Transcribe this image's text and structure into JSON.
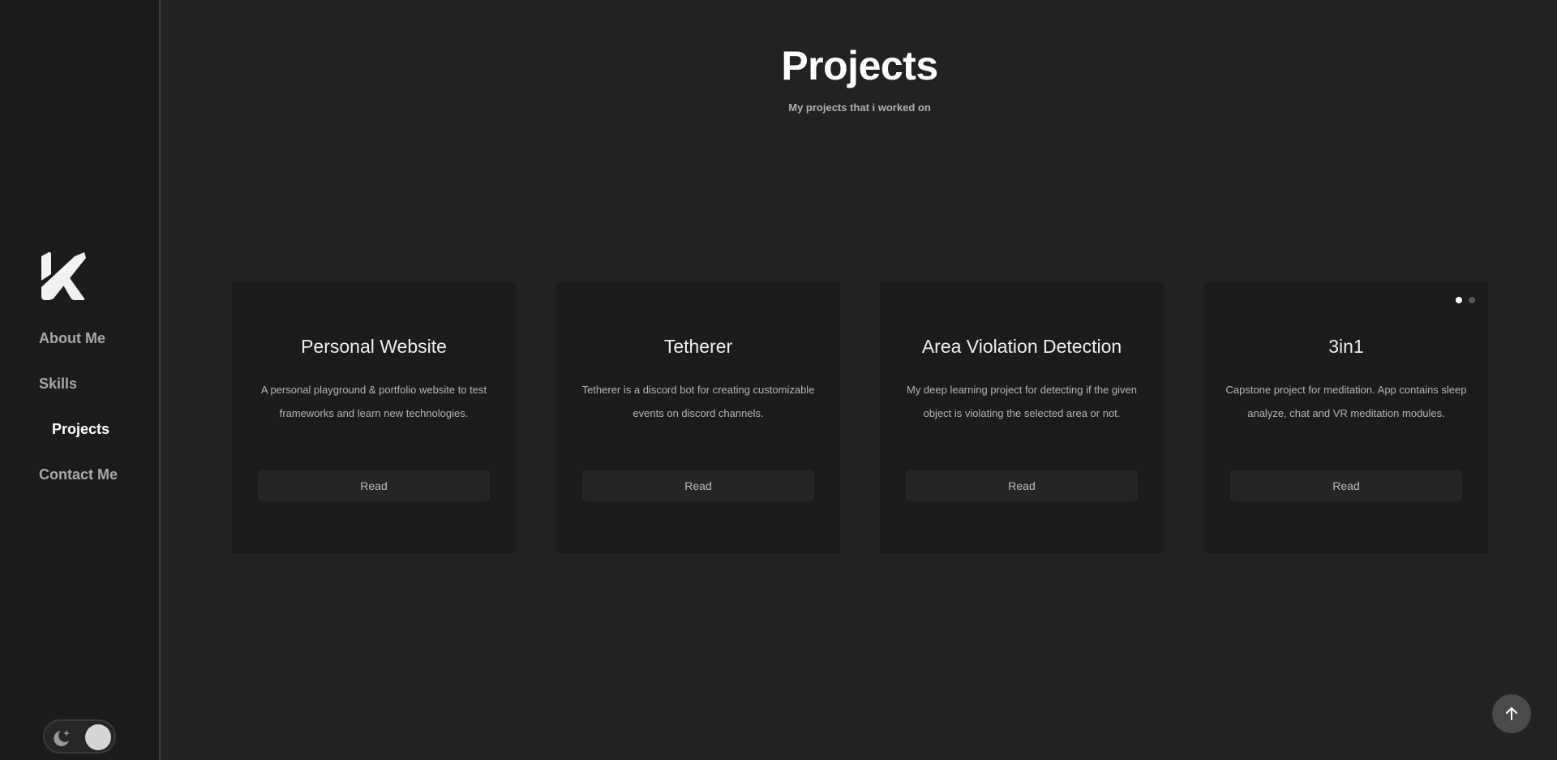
{
  "sidebar": {
    "logo_letter": "K",
    "nav": [
      {
        "label": "About Me",
        "active": false
      },
      {
        "label": "Skills",
        "active": false
      },
      {
        "label": "Projects",
        "active": true
      },
      {
        "label": "Contact Me",
        "active": false
      }
    ],
    "theme_toggle": {
      "icon": "moon-stars-icon",
      "mode": "dark"
    }
  },
  "header": {
    "title": "Projects",
    "subtitle": "My projects that i worked on"
  },
  "projects": [
    {
      "title": "Personal Website",
      "description": "A personal playground & portfolio website to test frameworks and learn new technologies.",
      "button": "Read"
    },
    {
      "title": "Tetherer",
      "description": "Tetherer is a discord bot for creating customizable events on discord channels.",
      "button": "Read"
    },
    {
      "title": "Area Violation Detection",
      "description": "My deep learning project for detecting if the given object is violating the selected area or not.",
      "button": "Read"
    },
    {
      "title": "3in1",
      "description": "Capstone project for meditation. App contains sleep analyze, chat and VR meditation modules.",
      "button": "Read"
    }
  ],
  "pagination": {
    "pages": 2,
    "current": 1
  },
  "scroll_top": {
    "icon": "arrow-up-icon"
  },
  "colors": {
    "background": "#222222",
    "sidebar": "#1b1b1b",
    "card": "#1b1b1b",
    "button": "#252525",
    "text_primary": "#ffffff",
    "text_muted": "#a8a8a8"
  }
}
